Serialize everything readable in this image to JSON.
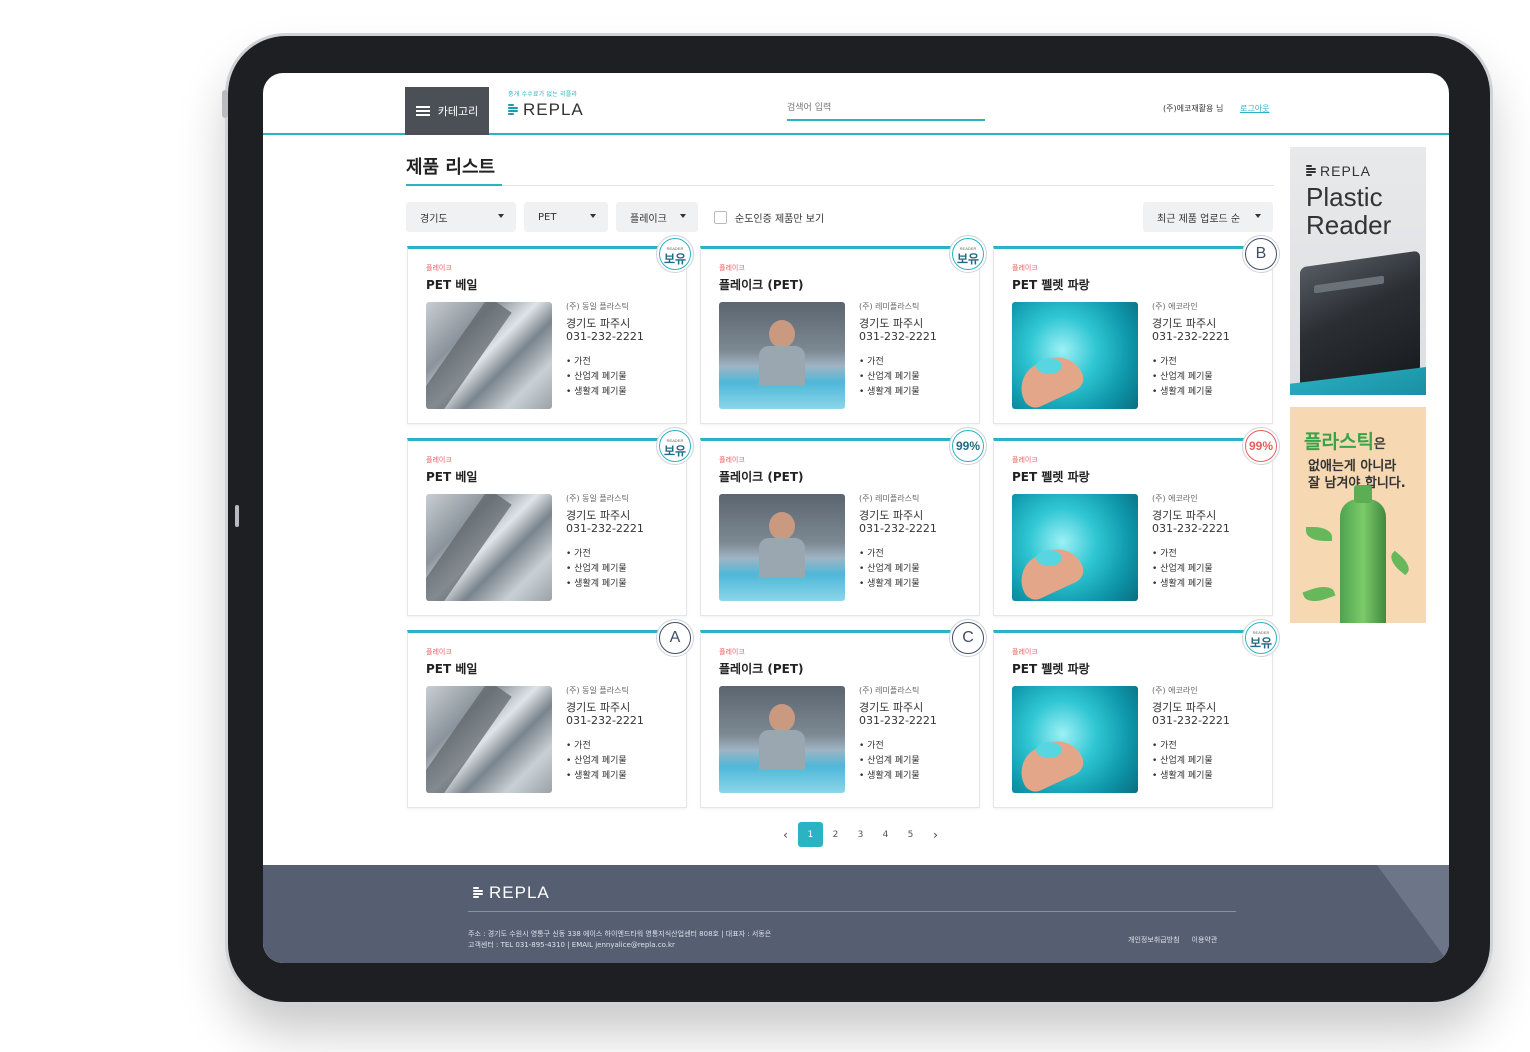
{
  "header": {
    "category_label": "카테고리",
    "logo_tagline": "중개 수수료가 없는 리플라",
    "logo_text": "REPLA",
    "search_placeholder": "검색어 입력",
    "user_label": "(주)에코재활용 님",
    "logout_label": "로그아웃"
  },
  "page": {
    "title": "제품 리스트"
  },
  "filters": {
    "region": "경기도",
    "material": "PET",
    "form": "플레이크",
    "certified_only_label": "순도인증 제품만 보기",
    "certified_only_checked": false,
    "sort": "최근 제품 업로드 순"
  },
  "products": [
    {
      "category": "플레이크",
      "name": "PET 베일",
      "company": "(주) 동일 플라스틱",
      "region": "경기도 파주시",
      "phone": "031-232-2221",
      "tags": [
        "가전",
        "산업계 폐기물",
        "생활계 폐기물"
      ],
      "image": "bale",
      "badge": {
        "type": "reader",
        "text": "보유",
        "sub": "READER"
      }
    },
    {
      "category": "플레이크",
      "name": "플레이크 (PET)",
      "company": "(주) 레미플라스틱",
      "region": "경기도 파주시",
      "phone": "031-232-2221",
      "tags": [
        "가전",
        "산업계 폐기물",
        "생활계 폐기물"
      ],
      "image": "worker",
      "badge": {
        "type": "reader",
        "text": "보유",
        "sub": "READER"
      }
    },
    {
      "category": "플레이크",
      "name": "PET 펠렛 파랑",
      "company": "(주) 에코라인",
      "region": "경기도 파주시",
      "phone": "031-232-2221",
      "tags": [
        "가전",
        "산업계 폐기물",
        "생활계 폐기물"
      ],
      "image": "flake",
      "badge": {
        "type": "grade",
        "text": "B"
      }
    },
    {
      "category": "플레이크",
      "name": "PET 베일",
      "company": "(주) 동일 플라스틱",
      "region": "경기도 파주시",
      "phone": "031-232-2221",
      "tags": [
        "가전",
        "산업계 폐기물",
        "생활계 폐기물"
      ],
      "image": "bale",
      "badge": {
        "type": "reader",
        "text": "보유",
        "sub": "READER"
      }
    },
    {
      "category": "플레이크",
      "name": "플레이크 (PET)",
      "company": "(주) 레미플라스틱",
      "region": "경기도 파주시",
      "phone": "031-232-2221",
      "tags": [
        "가전",
        "산업계 폐기물",
        "생활계 폐기물"
      ],
      "image": "worker",
      "badge": {
        "type": "pct",
        "text": "99%"
      }
    },
    {
      "category": "플레이크",
      "name": "PET 펠렛 파랑",
      "company": "(주) 에코라인",
      "region": "경기도 파주시",
      "phone": "031-232-2221",
      "tags": [
        "가전",
        "산업계 폐기물",
        "생활계 폐기물"
      ],
      "image": "flake",
      "badge": {
        "type": "pct-red",
        "text": "99%"
      }
    },
    {
      "category": "플레이크",
      "name": "PET 베일",
      "company": "(주) 동일 플라스틱",
      "region": "경기도 파주시",
      "phone": "031-232-2221",
      "tags": [
        "가전",
        "산업계 폐기물",
        "생활계 폐기물"
      ],
      "image": "bale",
      "badge": {
        "type": "grade",
        "text": "A"
      }
    },
    {
      "category": "플레이크",
      "name": "플레이크 (PET)",
      "company": "(주) 레미플라스틱",
      "region": "경기도 파주시",
      "phone": "031-232-2221",
      "tags": [
        "가전",
        "산업계 폐기물",
        "생활계 폐기물"
      ],
      "image": "worker",
      "badge": {
        "type": "grade",
        "text": "C"
      }
    },
    {
      "category": "플레이크",
      "name": "PET 펠렛 파랑",
      "company": "(주) 에코라인",
      "region": "경기도 파주시",
      "phone": "031-232-2221",
      "tags": [
        "가전",
        "산업계 폐기물",
        "생활계 폐기물"
      ],
      "image": "flake",
      "badge": {
        "type": "reader",
        "text": "보유",
        "sub": "READER"
      }
    }
  ],
  "pagination": {
    "pages": [
      "1",
      "2",
      "3",
      "4",
      "5"
    ],
    "current": "1",
    "prev": "‹",
    "next": "›"
  },
  "ads": {
    "reader": {
      "logo": "REPLA",
      "title_line1": "Plastic",
      "title_line2": "Reader"
    },
    "campaign": {
      "word": "플라스틱",
      "particle": "은",
      "line2": "없애는게 아니라",
      "line3": "잘 남겨야 합니다."
    }
  },
  "footer": {
    "logo": "REPLA",
    "address": "주소 : 경기도 수원시 영통구 신동 338 에이스 하이엔드타워 영통지식산업센터 808호  |  대표자 : 서동은",
    "contact": "고객센터 : TEL 031-895-4310  |  EMAIL jennyalice@repla.co.kr",
    "privacy": "개인정보취급방침",
    "terms": "이용약관"
  },
  "colors": {
    "accent": "#2bb3c4",
    "footer": "#565f72",
    "category": "#e85d5d"
  }
}
